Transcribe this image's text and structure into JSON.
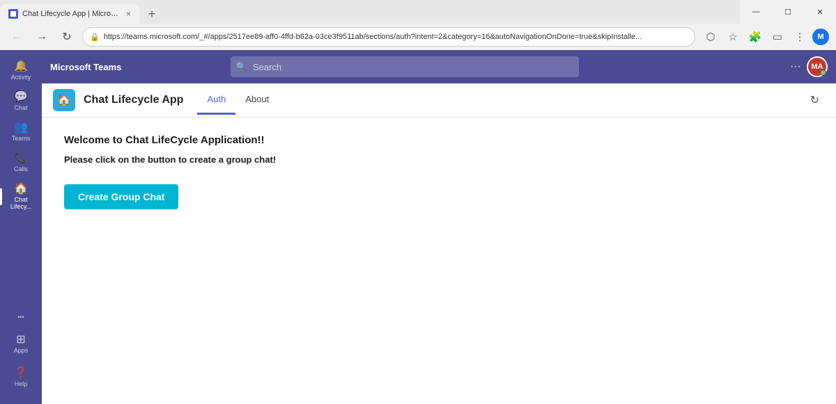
{
  "browser": {
    "tab": {
      "title": "Chat Lifecycle App | Microsoft Te...",
      "close_label": "×"
    },
    "new_tab_label": "+",
    "window_controls": {
      "minimize": "—",
      "maximize": "☐",
      "close": "✕"
    },
    "address_bar": {
      "url": "https://teams.microsoft.com/_#/apps/2517ee89-aff0-4ffd-b62a-03ce3f9511ab/sections/auth?intent=2&category=16&autoNavigationOnDone=true&skipInstalle...",
      "lock_icon": "🔒"
    }
  },
  "teams": {
    "header": {
      "title": "Microsoft Teams",
      "search_placeholder": "Search"
    },
    "sidebar": {
      "items": [
        {
          "id": "activity",
          "label": "Activity",
          "icon": "🔔"
        },
        {
          "id": "chat",
          "label": "Chat",
          "icon": "💬"
        },
        {
          "id": "teams",
          "label": "Teams",
          "icon": "👥"
        },
        {
          "id": "calls",
          "label": "Calls",
          "icon": "📞"
        },
        {
          "id": "chat-lifecycle",
          "label": "Chat Lifecy...",
          "icon": "🏠",
          "active": true
        }
      ],
      "more_label": "•••",
      "apps_label": "Apps",
      "help_label": "Help"
    },
    "avatar": {
      "initials": "MA"
    }
  },
  "app": {
    "icon_label": "🏠",
    "title": "Chat Lifecycle App",
    "tabs": [
      {
        "id": "auth",
        "label": "Auth",
        "active": true
      },
      {
        "id": "about",
        "label": "About",
        "active": false
      }
    ],
    "content": {
      "heading": "Welcome to Chat LifeCycle Application!!",
      "subtext": "Please click on the button to create a group chat!",
      "button_label": "Create Group Chat"
    }
  }
}
